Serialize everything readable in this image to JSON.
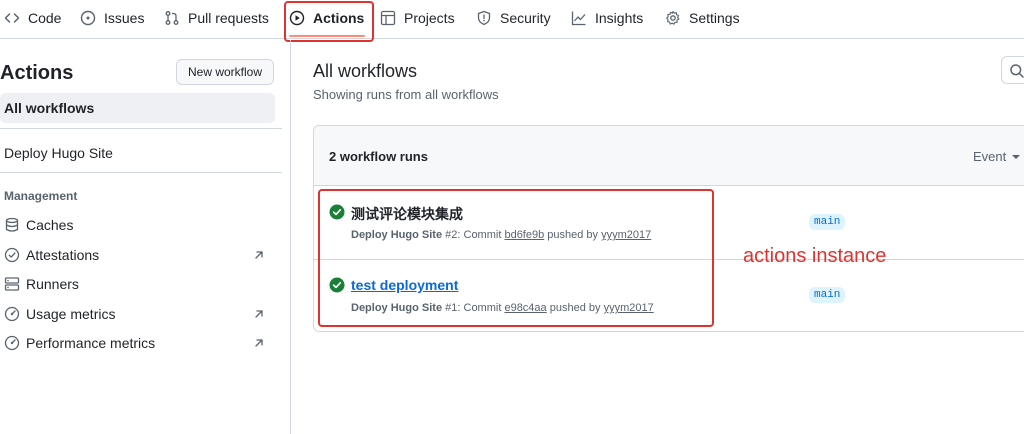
{
  "nav": {
    "code": "Code",
    "issues": "Issues",
    "pull_requests": "Pull requests",
    "actions": "Actions",
    "projects": "Projects",
    "security": "Security",
    "insights": "Insights",
    "settings": "Settings"
  },
  "sidebar": {
    "title": "Actions",
    "new_workflow": "New workflow",
    "all_workflows": "All workflows",
    "workflow": "Deploy Hugo Site",
    "management_heading": "Management",
    "management_items": [
      "Caches",
      "Attestations",
      "Runners",
      "Usage metrics",
      "Performance metrics"
    ]
  },
  "main": {
    "title": "All workflows",
    "subtitle": "Showing runs from all workflows",
    "runs_count": "2 workflow runs",
    "event_filter": "Event",
    "runs": [
      {
        "title": "测试评论模块集成",
        "workflow": "Deploy Hugo Site",
        "run_number": "#2",
        "commit_label": "Commit",
        "commit": "bd6fe9b",
        "pushed_by": "pushed by",
        "actor": "yyym2017",
        "branch": "main",
        "status": "success"
      },
      {
        "title": "test deployment",
        "workflow": "Deploy Hugo Site",
        "run_number": "#1",
        "commit_label": "Commit",
        "commit": "e98c4aa",
        "pushed_by": "pushed by",
        "actor": "yyym2017",
        "branch": "main",
        "status": "success"
      }
    ]
  },
  "annotation": {
    "label": "actions instance",
    "color": "#e0332f"
  },
  "colors": {
    "success": "#1a7f37",
    "link": "#0969da",
    "tab_underline": "#fd8c73"
  }
}
